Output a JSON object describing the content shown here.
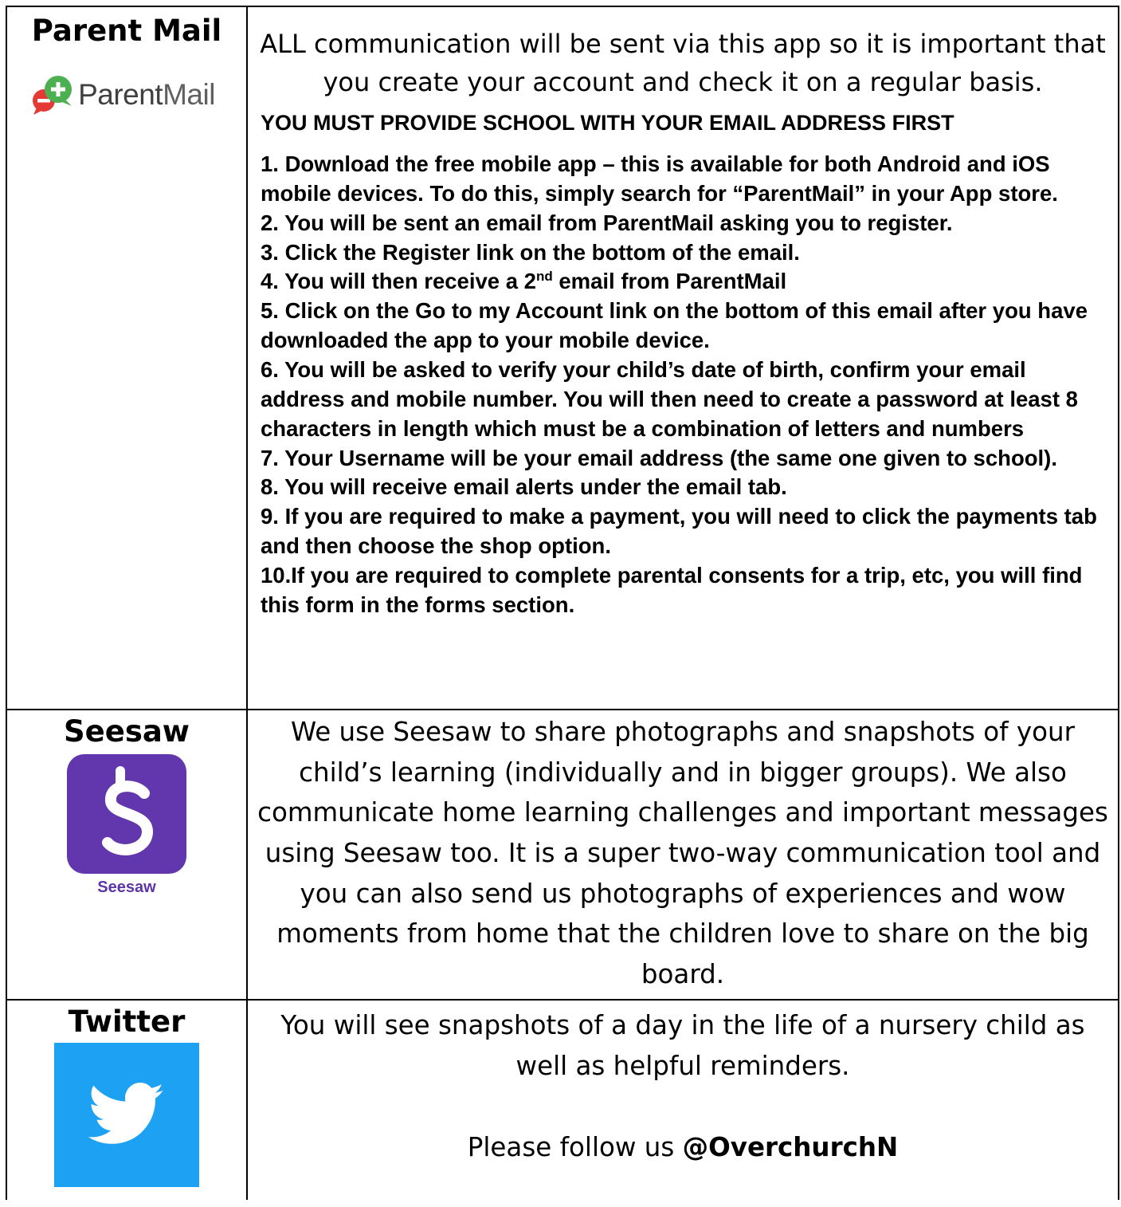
{
  "parent_mail": {
    "name": "Parent Mail",
    "logo_text_a": "Parent",
    "logo_text_b": "Mail",
    "intro": "ALL communication will be sent via this app so it is important that you create your account and check it on a regular basis.",
    "must_provide": "YOU MUST PROVIDE SCHOOL WITH YOUR EMAIL ADDRESS FIRST",
    "steps": [
      "1. Download the free mobile app – this is available for both Android and iOS mobile devices.  To do this, simply search for “ParentMail” in your App store.",
      "2. You will be sent an email from ParentMail asking you to register.",
      "3. Click the Register link on the bottom of the email.",
      "4. You will then receive a 2",
      "5. Click on the Go to my Account link on the bottom of this email after you have downloaded the app to your mobile device.",
      "6. You will be asked to verify your child’s date of birth, confirm your email address and mobile number.  You will then need to create a password at least 8 characters in length which must be a combination of letters and numbers",
      "7. Your Username will be your email address (the same one given to school).",
      "8. You will receive email alerts under the email tab.",
      "9. If you are required to make a payment, you will need to click the payments tab and then choose the shop option.",
      "10.If you are required to complete parental consents for a trip, etc, you will find this form in the forms section."
    ],
    "step4_sup": "nd",
    "step4_tail": " email from ParentMail",
    "brand_green": "#4caf50",
    "brand_red": "#e53935"
  },
  "seesaw": {
    "name": "Seesaw",
    "logo_caption": "Seesaw",
    "description": "We use Seesaw to share photographs and snapshots of your child’s learning (individually and in bigger groups).  We also communicate home learning challenges and important messages using Seesaw too.  It is a super two-way communication tool and you can also send us photographs of experiences and wow moments from home that the children love to share on the big board.",
    "brand_color": "#6236ac"
  },
  "twitter": {
    "name": "Twitter",
    "description": "You will see snapshots of a day in the life of a nursery child as well as helpful reminders.",
    "follow_prefix": "Please follow us ",
    "handle": "@OverchurchN",
    "brand_color": "#1da1f2"
  }
}
